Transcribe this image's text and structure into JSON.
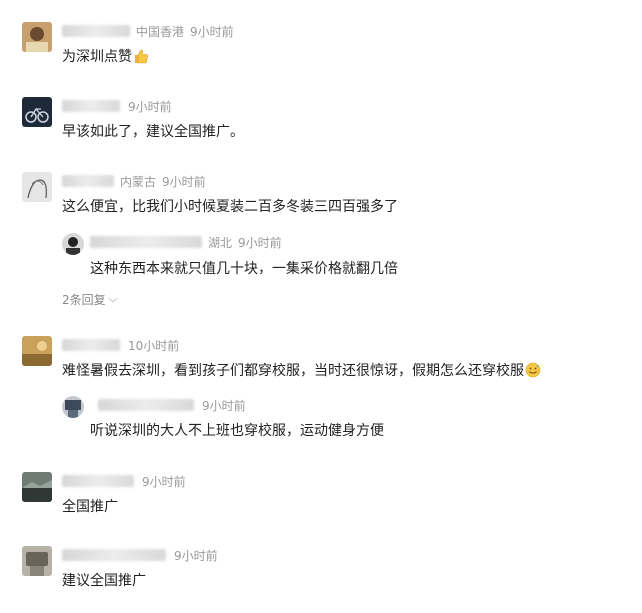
{
  "comments": [
    {
      "location": "中国香港",
      "time": "9小时前",
      "text": "为深圳点赞",
      "emoji": "thumbs-up-icon"
    },
    {
      "location": "",
      "time": "9小时前",
      "text": "早该如此了，建议全国推广。"
    },
    {
      "location": "内蒙古",
      "time": "9小时前",
      "text": "这么便宜，比我们小时候夏装二百多冬装三四百强多了",
      "reply": {
        "location": "湖北",
        "time": "9小时前",
        "text": "这种东西本来就只值几十块，一集采价格就翻几倍"
      },
      "more_replies": "2条回复"
    },
    {
      "location": "",
      "time": "10小时前",
      "text": "难怪暑假去深圳，看到孩子们都穿校服，当时还很惊讶，假期怎么还穿校服",
      "emoji": "sweat-smile-icon",
      "reply": {
        "location": "",
        "time": "9小时前",
        "text": "听说深圳的大人不上班也穿校服，运动健身方便"
      }
    },
    {
      "location": "",
      "time": "9小时前",
      "text": "全国推广"
    },
    {
      "location": "",
      "time": "9小时前",
      "text": "建议全国推广"
    }
  ]
}
